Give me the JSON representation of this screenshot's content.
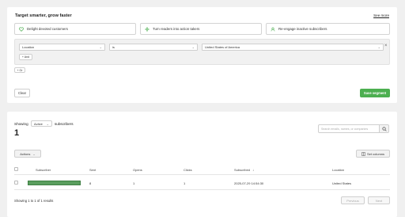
{
  "segment": {
    "title": "Target smarter, grow faster",
    "see_more": "See more",
    "goals": [
      {
        "label": "Delight devoted customers",
        "icon": "heart-icon"
      },
      {
        "label": "Turn readers into action takers",
        "icon": "sparkle-icon"
      },
      {
        "label": "Re-engage inactive subscribers",
        "icon": "refresh-user-icon"
      }
    ],
    "filter": {
      "field": "Location",
      "operator": "is",
      "value": "United States of America"
    },
    "add_and": "+ And",
    "add_or": "+ Or",
    "clear": "Clear",
    "save": "Save segment"
  },
  "subscribers": {
    "showing_label": "Showing",
    "status": "Active",
    "subscribers_label": "subscribers",
    "count": "1",
    "search_placeholder": "Search emails, names, or companies",
    "actions": "Actions",
    "set_columns": "Set columns",
    "columns": [
      "Subscriber",
      "Sent",
      "Opens",
      "Clicks",
      "Subscribed",
      "Location"
    ],
    "sort_indicator": "↓",
    "rows": [
      {
        "sent": "8",
        "opens": "1",
        "clicks": "1",
        "subscribed": "2025-07-29 14:54:30",
        "location": "United States"
      }
    ],
    "footer": "Showing 1 to 1 of 1 results",
    "previous": "Previous",
    "next": "Next"
  },
  "colors": {
    "accent": "#4caf50",
    "redacted": "#5a9e5e",
    "background": "#f0f0f0"
  }
}
